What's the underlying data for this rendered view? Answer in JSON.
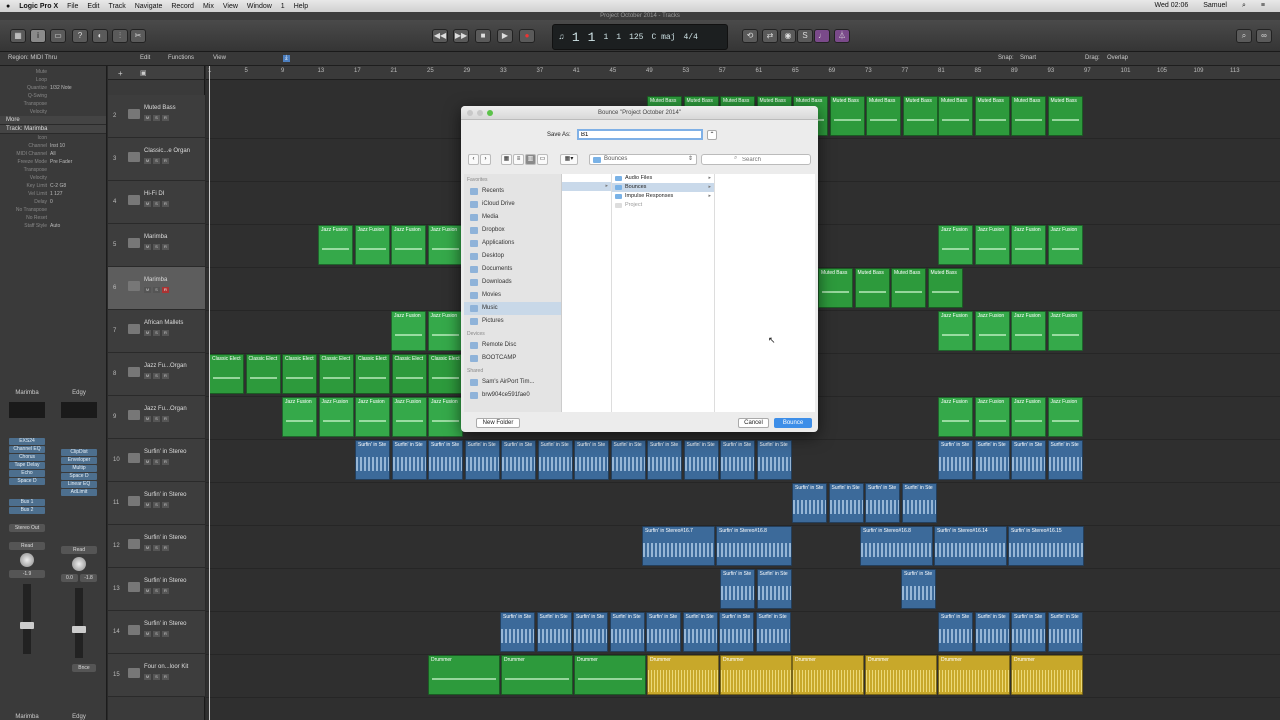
{
  "menubar": {
    "apple": "",
    "app": "Logic Pro X",
    "items": [
      "File",
      "Edit",
      "Track",
      "Navigate",
      "Record",
      "Mix",
      "View",
      "Window",
      "1",
      "Help"
    ],
    "clock": "Wed 02:06",
    "user": "Samuel"
  },
  "window": {
    "title": "Project October 2014 - Tracks"
  },
  "lcd": {
    "bar": "1",
    "beat": "1",
    "div": "1",
    "tick": "1",
    "tempo": "125",
    "key": "C maj",
    "sig": "4/4"
  },
  "row2": {
    "region": "Region: MIDI Thru",
    "edit": "Edit",
    "functions": "Functions",
    "view": "View",
    "snap_label": "Snap:",
    "snap": "Smart",
    "drag_label": "Drag:",
    "drag": "Overlap"
  },
  "inspector": {
    "region_params": [
      [
        "Mute",
        ""
      ],
      [
        "Loop",
        ""
      ],
      [
        "Quantize",
        "1/32 Note"
      ],
      [
        "Q-Swing",
        ""
      ],
      [
        "Transpose",
        ""
      ],
      [
        "Velocity",
        ""
      ]
    ],
    "more": "More",
    "track_head": "Track: Marimba",
    "track_params": [
      [
        "Icon",
        ""
      ],
      [
        "Channel",
        "Inst 10"
      ],
      [
        "MIDI Channel",
        "All"
      ],
      [
        "Freeze Mode",
        "Pre Fader"
      ],
      [
        "Transpose",
        ""
      ],
      [
        "Velocity",
        ""
      ],
      [
        "Key Limit",
        "C-2   G8"
      ],
      [
        "Vel Limit",
        "1   127"
      ],
      [
        "Delay",
        "0"
      ],
      [
        "No Transpose",
        ""
      ],
      [
        "No Reset",
        ""
      ],
      [
        "Staff Style",
        "Auto"
      ]
    ],
    "strip1": {
      "setting": "Marimba",
      "inst": "EXS24",
      "slots": [
        "Channel EQ",
        "Chorus",
        "Tape Delay",
        "Echo",
        "Space D"
      ],
      "sends": [
        "Bus 1",
        "Bus 2"
      ],
      "out": "Stereo Out",
      "auto": "Read",
      "vol": "-1.9",
      "name": "Marimba"
    },
    "strip2": {
      "setting": "Edgy",
      "slots": [
        "ClipDist",
        "Enveloper",
        "Multip",
        "Space D",
        "Linear EQ",
        "AdLimit"
      ],
      "auto": "Read",
      "vol1": "0.0",
      "vol2": "-1.8",
      "bnce": "Bnce",
      "name": "Edgy"
    }
  },
  "tracks": [
    {
      "n": "2",
      "name": "Muted Bass"
    },
    {
      "n": "3",
      "name": "Classic...e Organ"
    },
    {
      "n": "4",
      "name": "Hi-Fi DI"
    },
    {
      "n": "5",
      "name": "Marimba"
    },
    {
      "n": "6",
      "name": "Marimba",
      "sel": true
    },
    {
      "n": "7",
      "name": "African Mallets"
    },
    {
      "n": "8",
      "name": "Jazz Fu...Organ"
    },
    {
      "n": "9",
      "name": "Jazz Fu...Organ"
    },
    {
      "n": "10",
      "name": "Surfin' in Stereo"
    },
    {
      "n": "11",
      "name": "Surfin' in Stereo"
    },
    {
      "n": "12",
      "name": "Surfin' in Stereo"
    },
    {
      "n": "13",
      "name": "Surfin' in Stereo"
    },
    {
      "n": "14",
      "name": "Surfin' in Stereo"
    },
    {
      "n": "15",
      "name": "Four on...loor Kit"
    }
  ],
  "ruler": [
    "1",
    "5",
    "9",
    "13",
    "17",
    "21",
    "25",
    "29",
    "33",
    "37",
    "41",
    "45",
    "49",
    "53",
    "57",
    "61",
    "65",
    "69",
    "73",
    "77",
    "81",
    "85",
    "89",
    "93",
    "97",
    "101",
    "105",
    "109",
    "113"
  ],
  "region_labels": {
    "muted": "Muted Bass",
    "jazz": "Jazz Fusion",
    "classic": "Classic Elect",
    "surf": "Surfin' in Ste",
    "surf2": "Surfin' in Stereo#16.7",
    "surf3": "Surfin' in Stereo#16.8",
    "surf4": "Surfin' in Stereo#16.14",
    "surf5": "Surfin' in Stereo#16.15",
    "drummer": "Drummer"
  },
  "dialog": {
    "title": "Bounce \"Project October 2014\"",
    "save_as_label": "Save As:",
    "save_as_value": "B1",
    "location": "Bounces",
    "search_placeholder": "Search",
    "favorites_label": "Favorites",
    "favorites": [
      "Recents",
      "iCloud Drive",
      "Media",
      "Dropbox",
      "Applications",
      "Desktop",
      "Documents",
      "Downloads",
      "Movies",
      "Music",
      "Pictures"
    ],
    "selected_favorite": "Music",
    "devices_label": "Devices",
    "devices": [
      "Remote Disc",
      "BOOTCAMP"
    ],
    "shared_label": "Shared",
    "shared": [
      "Sam's AirPort Tim...",
      "brw904ce591fae0"
    ],
    "folders": [
      {
        "name": "Audio Files",
        "folder": true
      },
      {
        "name": "Bounces",
        "folder": true,
        "sel": true
      },
      {
        "name": "Impulse Responses",
        "folder": true
      },
      {
        "name": "Project",
        "folder": false
      }
    ],
    "new_folder": "New Folder",
    "cancel": "Cancel",
    "bounce": "Bounce"
  },
  "colors": {
    "midi": "#2d9a3c",
    "audio": "#3c6a9a",
    "drummer": "#c8a82a",
    "accent": "#3d8ee8"
  }
}
